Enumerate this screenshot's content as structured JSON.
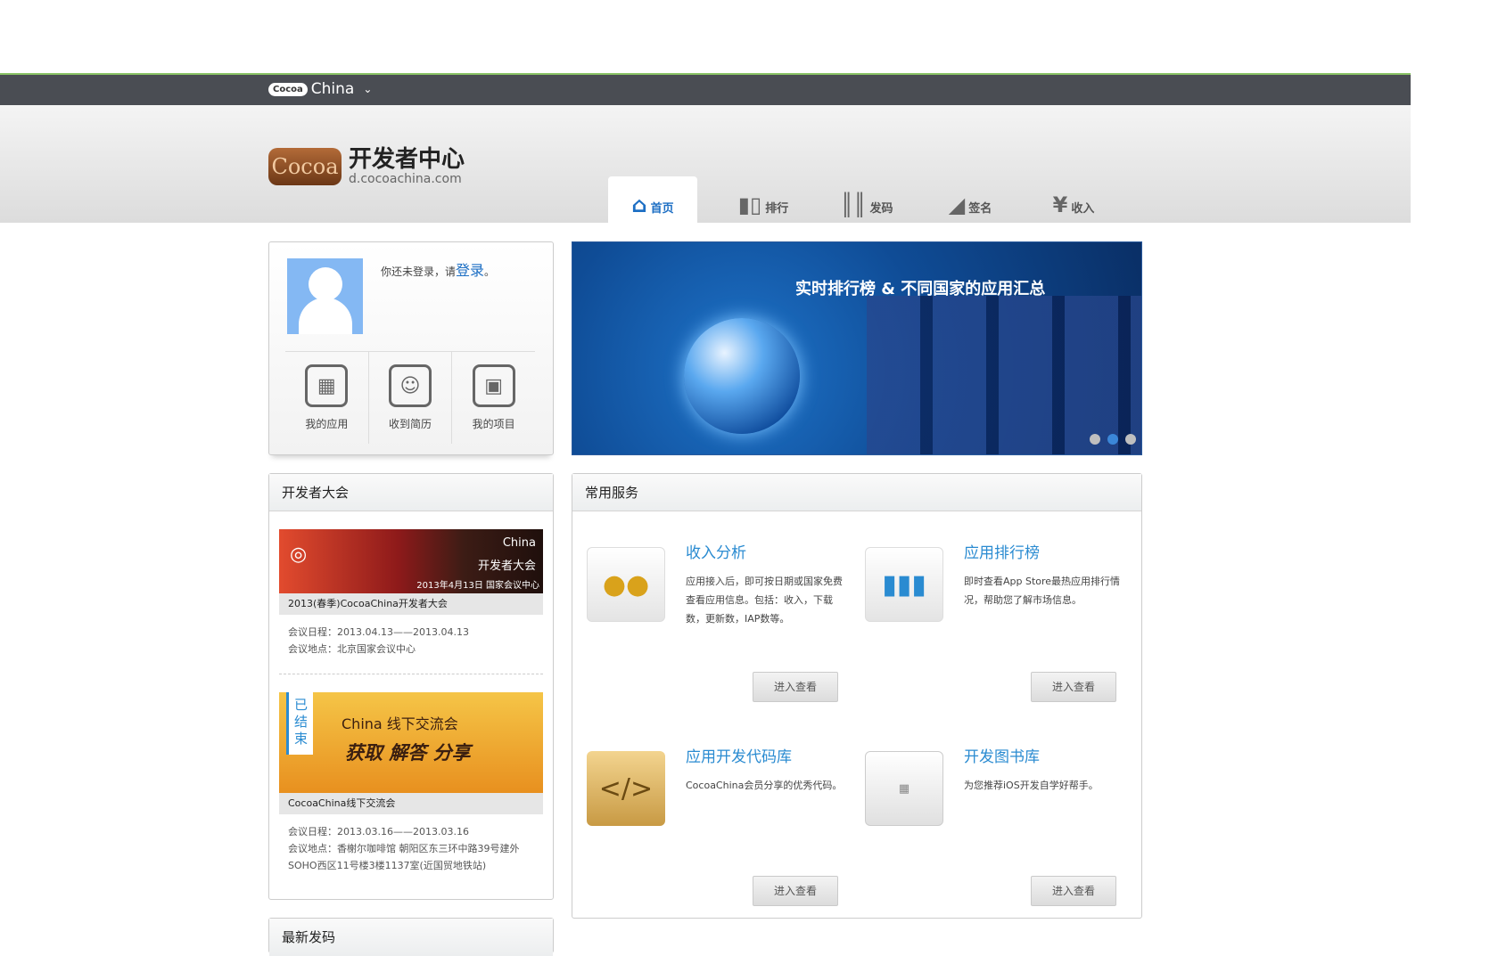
{
  "topbar": {
    "brand_pill": "Cocoa",
    "brand_text": "China"
  },
  "header": {
    "logo_badge": "Cocoa",
    "logo_title": "开发者中心",
    "logo_url": "d.cocoachina.com"
  },
  "nav": {
    "tabs": [
      {
        "label": "首页",
        "icon": "home-icon",
        "active": true
      },
      {
        "label": "排行",
        "icon": "bar-chart-icon"
      },
      {
        "label": "发码",
        "icon": "barcode-icon"
      },
      {
        "label": "签名",
        "icon": "tag-icon"
      },
      {
        "label": "收入",
        "icon": "yen-icon"
      }
    ]
  },
  "user": {
    "login_prefix": "你还未登录，请",
    "login_link": "登录",
    "login_suffix": "。",
    "links": [
      {
        "label": "我的应用",
        "icon": "apps-grid-icon"
      },
      {
        "label": "收到简历",
        "icon": "resume-icon"
      },
      {
        "label": "我的项目",
        "icon": "box-icon"
      }
    ]
  },
  "banner": {
    "title": "实时排行榜 & 不同国家的应用汇总",
    "slides": 3,
    "active_slide": 2
  },
  "conference": {
    "heading": "开发者大会",
    "items": [
      {
        "overlay_brand": "China",
        "overlay_title": "开发者大会",
        "overlay_date": "2013年4月13日 国家会议中心",
        "caption": "2013(春季)CocoaChina开发者大会",
        "date": "会议日程：2013.04.13——2013.04.13",
        "place": "会议地点：北京国家会议中心"
      },
      {
        "ended_label": "已结束",
        "overlay_brand": "China 线下交流会",
        "overlay_title": "获取 解答 分享",
        "caption": "CocoaChina线下交流会",
        "date": "会议日程：2013.03.16——2013.03.16",
        "place": "会议地点：香榭尔咖啡馆 朝阳区东三环中路39号建外SOHO西区11号楼3楼1137室(近国贸地铁站)"
      }
    ]
  },
  "services": {
    "heading": "常用服务",
    "items": [
      {
        "title": "收入分析",
        "desc": "应用接入后，即可按日期或国家免费查看应用信息。包括：收入，下载数，更新数，IAP数等。",
        "button": "进入查看",
        "icon": "coins-icon"
      },
      {
        "title": "应用排行榜",
        "desc": "即时查看App Store最热应用排行情况，帮助您了解市场信息。",
        "button": "进入查看",
        "icon": "chart-icon"
      },
      {
        "title": "应用开发代码库",
        "desc": "CocoaChina会员分享的优秀代码。",
        "button": "进入查看",
        "icon": "code-icon"
      },
      {
        "title": "开发图书库",
        "desc": "为您推荐iOS开发自学好帮手。",
        "button": "进入查看",
        "icon": "book-icon"
      }
    ]
  },
  "next_panel": {
    "heading": "最新发码"
  }
}
